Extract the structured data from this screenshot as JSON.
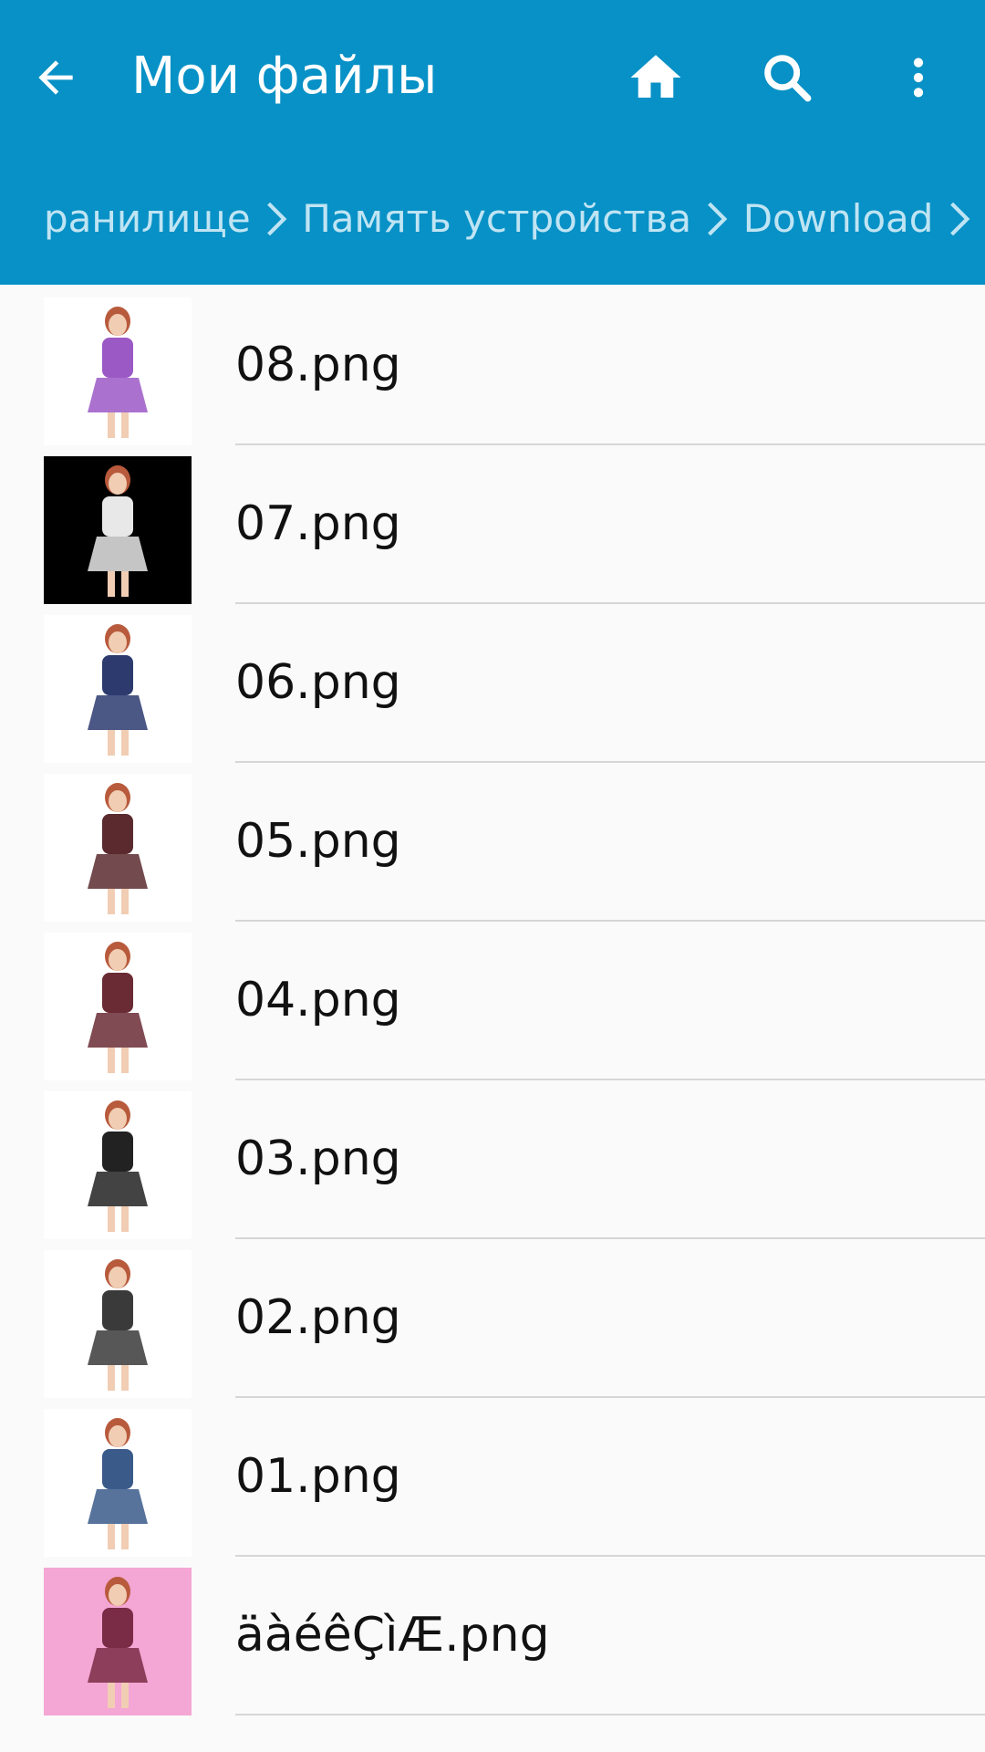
{
  "header": {
    "title": "Мои файлы",
    "background": "#0791c6",
    "icons": {
      "back": "arrow-left-icon",
      "home": "home-icon",
      "search": "search-icon",
      "more": "more-vertical-icon"
    }
  },
  "breadcrumb": {
    "items": [
      "ранилище",
      "Память устройства",
      "Download"
    ],
    "separator_icon": "chevron-right-icon"
  },
  "files": [
    {
      "name": "08.png",
      "thumb_bg": "#ffffff",
      "accent": "#9b59c6"
    },
    {
      "name": "07.png",
      "thumb_bg": "#000000",
      "accent": "#e8e8e8"
    },
    {
      "name": "06.png",
      "thumb_bg": "#ffffff",
      "accent": "#2c3a6e"
    },
    {
      "name": "05.png",
      "thumb_bg": "#ffffff",
      "accent": "#5a2a2e"
    },
    {
      "name": "04.png",
      "thumb_bg": "#ffffff",
      "accent": "#6a2b35"
    },
    {
      "name": "03.png",
      "thumb_bg": "#ffffff",
      "accent": "#222222"
    },
    {
      "name": "02.png",
      "thumb_bg": "#ffffff",
      "accent": "#3a3a3a"
    },
    {
      "name": "01.png",
      "thumb_bg": "#ffffff",
      "accent": "#3a5a8a"
    },
    {
      "name": "äàéêÇìÆ.png",
      "thumb_bg": "#f4a6d4",
      "accent": "#7a2b45"
    }
  ]
}
